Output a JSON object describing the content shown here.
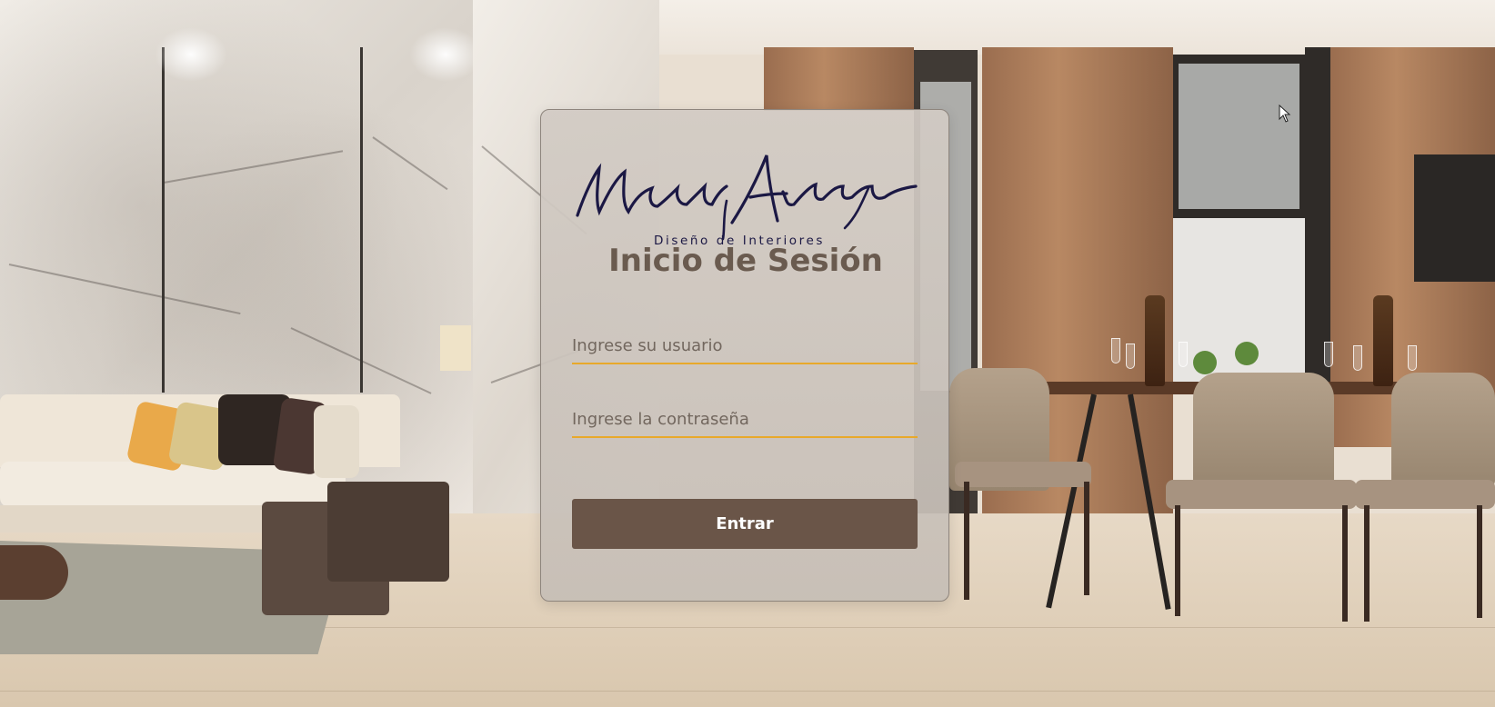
{
  "brand": {
    "logo_signature": "Maru Alvarenga",
    "logo_subtitle": "Diseño de Interiores"
  },
  "login": {
    "title": "Inicio de Sesión",
    "username_placeholder": "Ingrese su usuario",
    "password_placeholder": "Ingrese la contraseña",
    "submit_label": "Entrar"
  },
  "colors": {
    "accent_underline": "#e8a92a",
    "button_bg": "#6a5548",
    "title_text": "#6a5b4f",
    "logo_ink": "#1b1844"
  },
  "icons": {
    "cursor": "mouse-pointer-icon"
  }
}
